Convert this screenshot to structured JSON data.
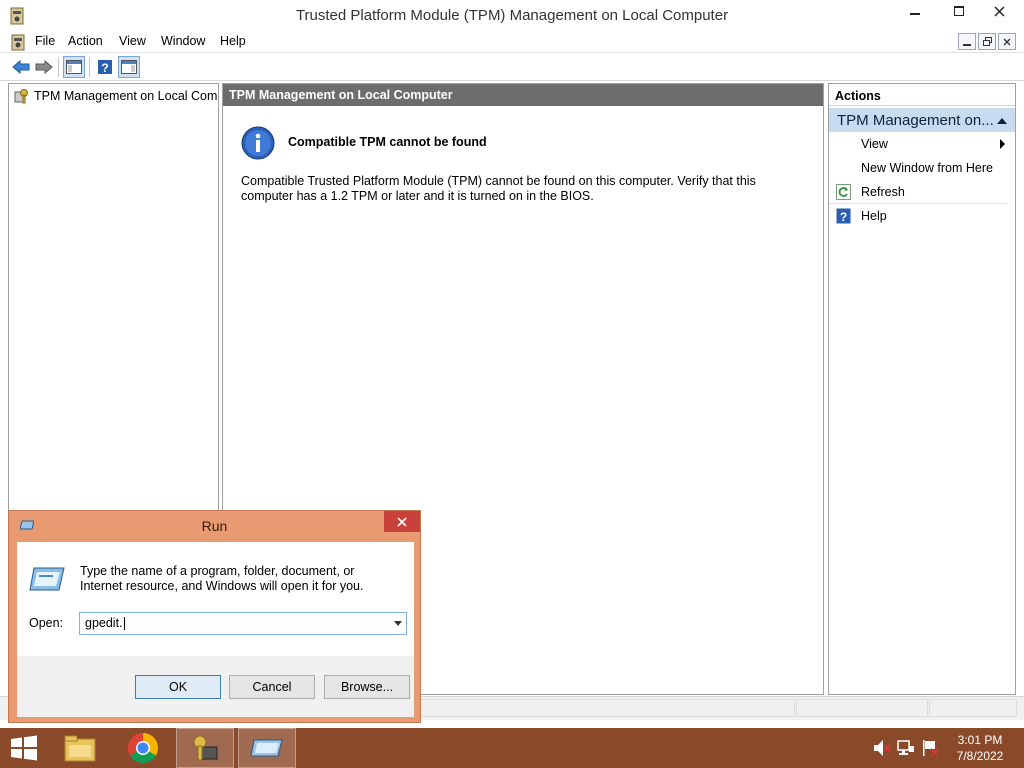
{
  "window": {
    "title": "Trusted Platform Module (TPM) Management on Local Computer"
  },
  "menu": [
    "File",
    "Action",
    "View",
    "Window",
    "Help"
  ],
  "tree": {
    "root_label": "TPM Management on Local Comp"
  },
  "center": {
    "header": "TPM Management on Local Computer",
    "message_title": "Compatible TPM cannot be found",
    "message_body": "Compatible Trusted Platform Module (TPM) cannot be found on this computer. Verify that this computer has a 1.2 TPM or later and it is turned on in the BIOS."
  },
  "actions": {
    "title": "Actions",
    "section": "TPM Management on...",
    "items": [
      {
        "label": "View",
        "icon": "none",
        "submenu": true
      },
      {
        "label": "New Window from Here",
        "icon": "none"
      },
      {
        "label": "Refresh",
        "icon": "refresh-icon"
      },
      {
        "label": "Help",
        "icon": "help-icon"
      }
    ]
  },
  "run_dialog": {
    "title": "Run",
    "description": "Type the name of a program, folder, document, or Internet resource, and Windows will open it for you.",
    "open_label": "Open:",
    "open_value": "gpedit.",
    "ok": "OK",
    "cancel": "Cancel",
    "browse": "Browse..."
  },
  "taskbar": {
    "time": "3:01 PM",
    "date": "7/8/2022"
  },
  "colors": {
    "taskbar": "#8a4a2a",
    "run_frame": "#e89b72",
    "actions_section": "#c8dcf0",
    "center_header": "#6d6d6d"
  }
}
